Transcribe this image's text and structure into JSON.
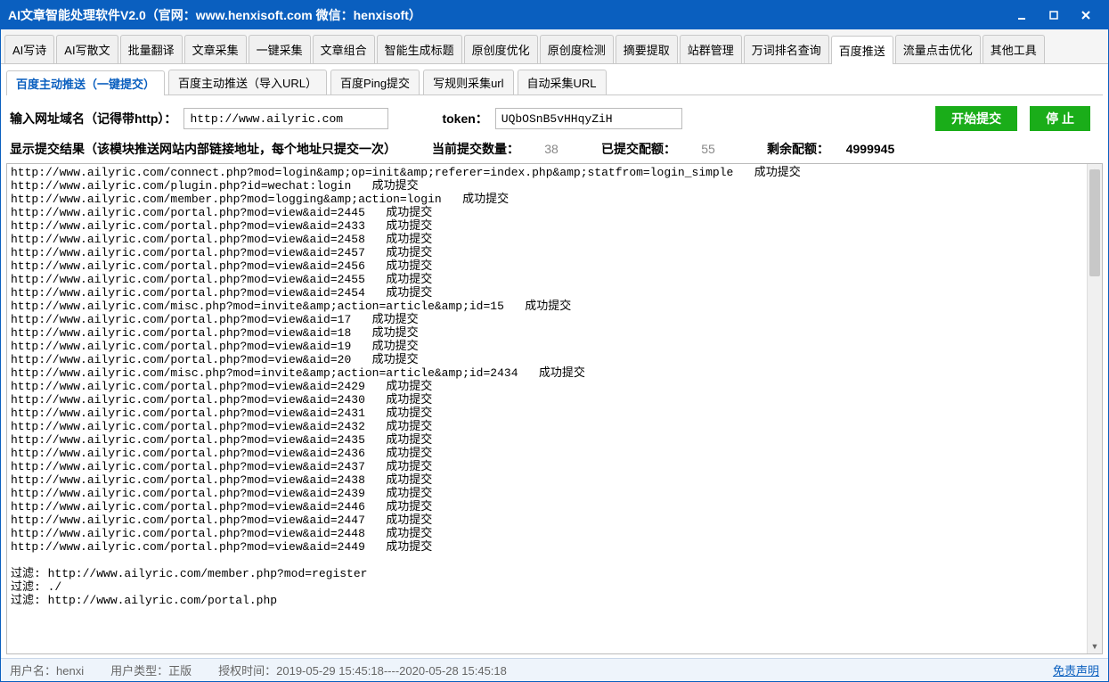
{
  "title": "AI文章智能处理软件V2.0（官网：www.henxisoft.com  微信：henxisoft）",
  "tabs": [
    "AI写诗",
    "AI写散文",
    "批量翻译",
    "文章采集",
    "一键采集",
    "文章组合",
    "智能生成标题",
    "原创度优化",
    "原创度检测",
    "摘要提取",
    "站群管理",
    "万词排名查询",
    "百度推送",
    "流量点击优化",
    "其他工具"
  ],
  "tabs_active_index": 12,
  "subtabs": [
    "百度主动推送（一键提交）",
    "百度主动推送（导入URL）",
    "百度Ping提交",
    "写规则采集url",
    "自动采集URL"
  ],
  "subtabs_active_index": 0,
  "form": {
    "domain_label": "输入网址域名（记得带http）：",
    "domain_value": "http://www.ailyric.com",
    "token_label": "token：",
    "token_value": "UQbOSnB5vHHqyZiH",
    "start_btn": "开始提交",
    "stop_btn": "停 止"
  },
  "status": {
    "result_label": "显示提交结果（该模块推送网站内部链接地址，每个地址只提交一次）",
    "current_label": "当前提交数量：",
    "current_value": "38",
    "submitted_label": "已提交配额：",
    "submitted_value": "55",
    "remain_label": "剩余配额：",
    "remain_value": "4999945"
  },
  "log_lines": [
    "http://www.ailyric.com/connect.php?mod=login&amp;op=init&amp;referer=index.php&amp;statfrom=login_simple   成功提交",
    "http://www.ailyric.com/plugin.php?id=wechat:login   成功提交",
    "http://www.ailyric.com/member.php?mod=logging&amp;action=login   成功提交",
    "http://www.ailyric.com/portal.php?mod=view&aid=2445   成功提交",
    "http://www.ailyric.com/portal.php?mod=view&aid=2433   成功提交",
    "http://www.ailyric.com/portal.php?mod=view&aid=2458   成功提交",
    "http://www.ailyric.com/portal.php?mod=view&aid=2457   成功提交",
    "http://www.ailyric.com/portal.php?mod=view&aid=2456   成功提交",
    "http://www.ailyric.com/portal.php?mod=view&aid=2455   成功提交",
    "http://www.ailyric.com/portal.php?mod=view&aid=2454   成功提交",
    "http://www.ailyric.com/misc.php?mod=invite&amp;action=article&amp;id=15   成功提交",
    "http://www.ailyric.com/portal.php?mod=view&aid=17   成功提交",
    "http://www.ailyric.com/portal.php?mod=view&aid=18   成功提交",
    "http://www.ailyric.com/portal.php?mod=view&aid=19   成功提交",
    "http://www.ailyric.com/portal.php?mod=view&aid=20   成功提交",
    "http://www.ailyric.com/misc.php?mod=invite&amp;action=article&amp;id=2434   成功提交",
    "http://www.ailyric.com/portal.php?mod=view&aid=2429   成功提交",
    "http://www.ailyric.com/portal.php?mod=view&aid=2430   成功提交",
    "http://www.ailyric.com/portal.php?mod=view&aid=2431   成功提交",
    "http://www.ailyric.com/portal.php?mod=view&aid=2432   成功提交",
    "http://www.ailyric.com/portal.php?mod=view&aid=2435   成功提交",
    "http://www.ailyric.com/portal.php?mod=view&aid=2436   成功提交",
    "http://www.ailyric.com/portal.php?mod=view&aid=2437   成功提交",
    "http://www.ailyric.com/portal.php?mod=view&aid=2438   成功提交",
    "http://www.ailyric.com/portal.php?mod=view&aid=2439   成功提交",
    "http://www.ailyric.com/portal.php?mod=view&aid=2446   成功提交",
    "http://www.ailyric.com/portal.php?mod=view&aid=2447   成功提交",
    "http://www.ailyric.com/portal.php?mod=view&aid=2448   成功提交",
    "http://www.ailyric.com/portal.php?mod=view&aid=2449   成功提交",
    "",
    "过滤: http://www.ailyric.com/member.php?mod=register",
    "过滤: ./",
    "过滤: http://www.ailyric.com/portal.php"
  ],
  "footer": {
    "user_label": "用户名：",
    "user_value": "henxi",
    "type_label": "用户类型：",
    "type_value": "正版",
    "auth_label": "授权时间：",
    "auth_value": "2019-05-29 15:45:18----2020-05-28 15:45:18",
    "disclaimer": "免责声明"
  }
}
